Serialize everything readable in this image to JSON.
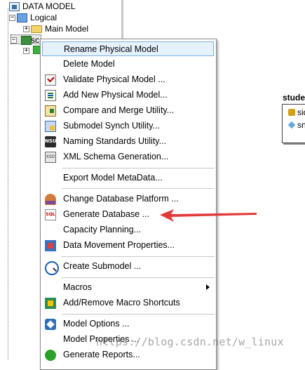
{
  "tree": {
    "root_label": "DATA MODEL",
    "logical_label": "Logical",
    "main_model_label": "Main Model",
    "physical_label": "sc"
  },
  "menu": {
    "items": [
      {
        "label": "Rename Physical Model",
        "icon": "none",
        "highlighted": true
      },
      {
        "label": "Delete Model",
        "icon": "none"
      },
      {
        "label": "Validate Physical Model ...",
        "icon": "validate-icon"
      },
      {
        "label": "Add New Physical Model...",
        "icon": "document-icon"
      },
      {
        "label": "Compare and Merge Utility...",
        "icon": "compare-icon"
      },
      {
        "label": "Submodel Synch Utility...",
        "icon": "submodel-sync-icon"
      },
      {
        "label": "Naming Standards Utility...",
        "icon": "nsu-icon",
        "icon_text": "NSU"
      },
      {
        "label": "XML Schema Generation...",
        "icon": "xsd-icon",
        "icon_text": "XSD"
      },
      {
        "label": "Export Model MetaData...",
        "icon": "none"
      },
      {
        "label": "Change Database Platform ...",
        "icon": "platform-icon"
      },
      {
        "label": "Generate Database ...",
        "icon": "sql-icon",
        "icon_text": "SQL"
      },
      {
        "label": "Capacity Planning...",
        "icon": "none"
      },
      {
        "label": "Data Movement Properties...",
        "icon": "data-movement-icon"
      },
      {
        "label": "Create Submodel ...",
        "icon": "magnifier-icon"
      },
      {
        "label": "Macros",
        "icon": "none",
        "submenu": true
      },
      {
        "label": "Add/Remove Macro Shortcuts",
        "icon": "macro-icon"
      },
      {
        "label": "Model Options ...",
        "icon": "options-icon"
      },
      {
        "label": "Model Properties ...",
        "icon": "none"
      },
      {
        "label": "Generate Reports...",
        "icon": "globe-icon"
      }
    ]
  },
  "entity": {
    "name": "stude",
    "attributes": [
      "sid",
      "sn"
    ]
  },
  "watermark": "https://blog.csdn.net/w_linux"
}
